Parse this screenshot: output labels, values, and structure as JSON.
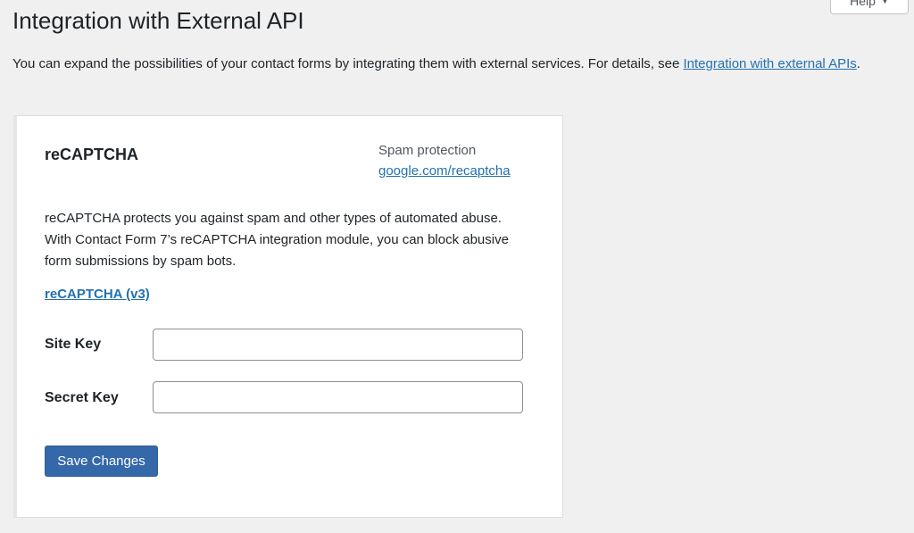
{
  "help_tab": {
    "label": "Help",
    "caret": "▼"
  },
  "page": {
    "title": "Integration with External API",
    "intro_text": "You can expand the possibilities of your contact forms by integrating them with external services. For details, see ",
    "intro_link": "Integration with external APIs",
    "intro_end": "."
  },
  "card": {
    "title": "reCAPTCHA",
    "meta_label": "Spam protection",
    "meta_link": "google.com/recaptcha",
    "description": "reCAPTCHA protects you against spam and other types of automated abuse. With Contact Form 7’s reCAPTCHA integration module, you can block abusive form submissions by spam bots.",
    "version_link": "reCAPTCHA (v3)",
    "fields": [
      {
        "label": "Site Key",
        "value": "",
        "placeholder": ""
      },
      {
        "label": "Secret Key",
        "value": "",
        "placeholder": ""
      }
    ],
    "save_label": "Save Changes"
  },
  "colors": {
    "background": "#f0f0f1",
    "link": "#2271b1",
    "primary_button": "#3468a8",
    "card_background": "#ffffff"
  }
}
